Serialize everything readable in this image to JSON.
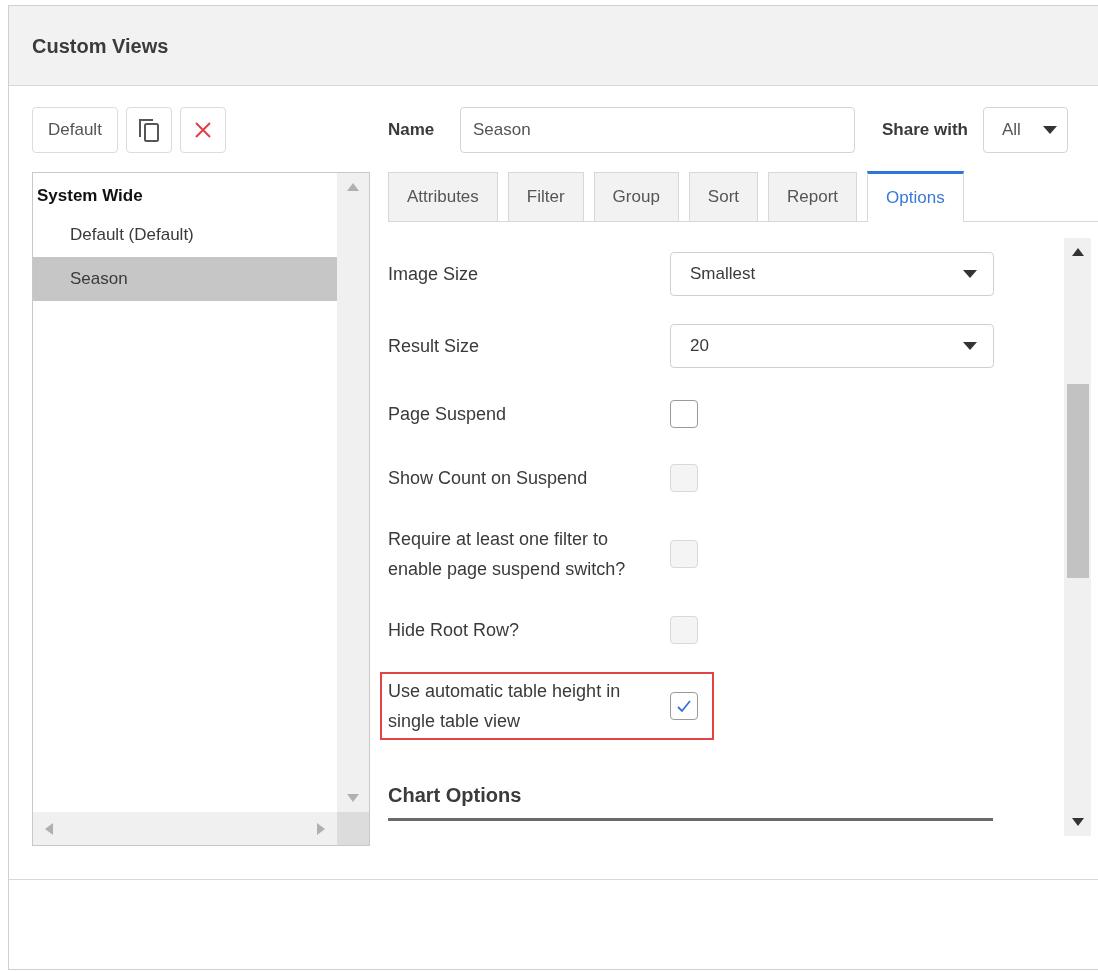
{
  "dialog": {
    "title": "Custom Views"
  },
  "toolbar": {
    "default_button": "Default"
  },
  "views_list": {
    "groups": [
      {
        "label": "System Wide",
        "children": [
          {
            "label": "Default (Default)",
            "selected": false
          },
          {
            "label": "Season",
            "selected": true
          }
        ]
      }
    ]
  },
  "name_field": {
    "label": "Name",
    "value": "Season"
  },
  "share": {
    "label": "Share with",
    "value": "All"
  },
  "tabs": [
    {
      "label": "Attributes",
      "selected": false
    },
    {
      "label": "Filter",
      "selected": false
    },
    {
      "label": "Group",
      "selected": false
    },
    {
      "label": "Sort",
      "selected": false
    },
    {
      "label": "Report",
      "selected": false
    },
    {
      "label": "Options",
      "selected": true
    }
  ],
  "options": [
    {
      "kind": "select",
      "label": "Image Size",
      "value": "Smallest",
      "highlighted": false
    },
    {
      "kind": "select",
      "label": "Result Size",
      "value": "20",
      "highlighted": false
    },
    {
      "kind": "checkbox",
      "label": "Page Suspend",
      "checked": false,
      "disabled": false,
      "highlighted": false
    },
    {
      "kind": "checkbox",
      "label": "Show Count on Suspend",
      "checked": false,
      "disabled": true,
      "highlighted": false
    },
    {
      "kind": "checkbox",
      "label": "Require at least one filter to enable page suspend switch?",
      "checked": false,
      "disabled": true,
      "highlighted": false
    },
    {
      "kind": "checkbox",
      "label": "Hide Root Row?",
      "checked": false,
      "disabled": true,
      "highlighted": false
    },
    {
      "kind": "checkbox",
      "label": "Use automatic table height in single table view",
      "checked": true,
      "disabled": false,
      "highlighted": true
    }
  ],
  "section_heading": "Chart Options"
}
